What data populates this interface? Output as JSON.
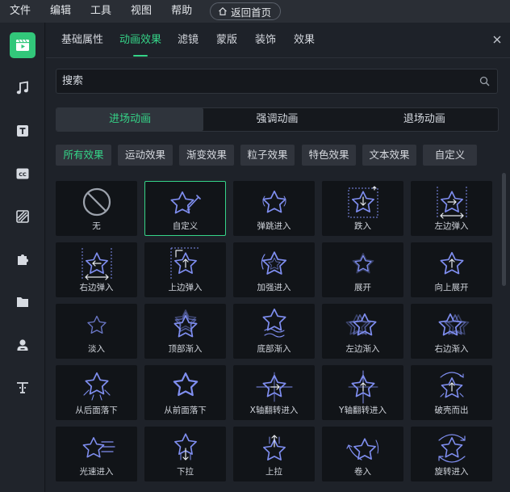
{
  "menu": {
    "items": [
      "文件",
      "编辑",
      "工具",
      "视图",
      "帮助"
    ],
    "home_label": "返回首页"
  },
  "rail": {
    "items": [
      "media-icon",
      "music-icon",
      "text-icon",
      "caption-icon",
      "filter-icon",
      "puzzle-icon",
      "folder-icon",
      "avatar-icon",
      "text-style-icon"
    ]
  },
  "tabs": [
    "基础属性",
    "动画效果",
    "滤镜",
    "蒙版",
    "装饰",
    "效果"
  ],
  "search": {
    "placeholder": "搜索"
  },
  "segments": [
    "进场动画",
    "强调动画",
    "退场动画"
  ],
  "chips": [
    "所有效果",
    "运动效果",
    "渐变效果",
    "粒子效果",
    "特色效果",
    "文本效果",
    "自定义"
  ],
  "effects": [
    {
      "label": "无"
    },
    {
      "label": "自定义"
    },
    {
      "label": "弹跳进入"
    },
    {
      "label": "跌入"
    },
    {
      "label": "左边弹入"
    },
    {
      "label": "右边弹入"
    },
    {
      "label": "上边弹入"
    },
    {
      "label": "加强进入"
    },
    {
      "label": "展开"
    },
    {
      "label": "向上展开"
    },
    {
      "label": "淡入"
    },
    {
      "label": "顶部渐入"
    },
    {
      "label": "底部渐入"
    },
    {
      "label": "左边渐入"
    },
    {
      "label": "右边渐入"
    },
    {
      "label": "从后面落下"
    },
    {
      "label": "从前面落下"
    },
    {
      "label": "X轴翻转进入"
    },
    {
      "label": "Y轴翻转进入"
    },
    {
      "label": "破壳而出"
    },
    {
      "label": "光速进入"
    },
    {
      "label": "下拉"
    },
    {
      "label": "上拉"
    },
    {
      "label": "卷入"
    },
    {
      "label": "旋转进入"
    }
  ],
  "colors": {
    "accent": "#35d488",
    "icon": "#7f8ef0"
  }
}
